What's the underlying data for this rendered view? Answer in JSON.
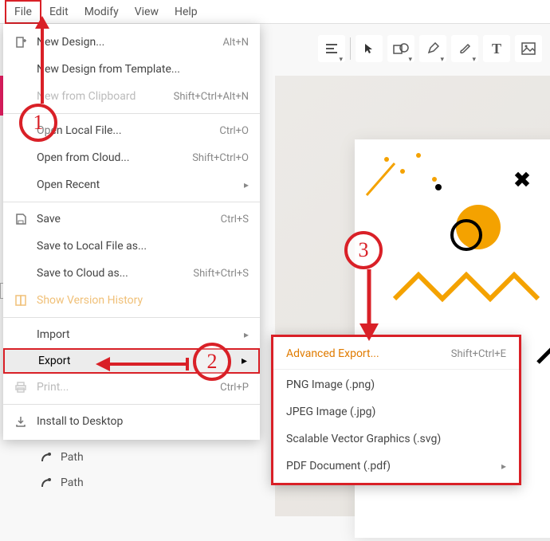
{
  "menubar": {
    "file": "File",
    "edit": "Edit",
    "modify": "Modify",
    "view": "View",
    "help": "Help"
  },
  "file_menu": {
    "new_design": {
      "label": "New Design...",
      "shortcut": "Alt+N"
    },
    "new_template": {
      "label": "New Design from Template..."
    },
    "new_clipboard": {
      "label": "New from Clipboard",
      "shortcut": "Shift+Ctrl+Alt+N"
    },
    "open_local": {
      "label": "Open Local File...",
      "shortcut": "Ctrl+O"
    },
    "open_cloud": {
      "label": "Open from Cloud...",
      "shortcut": "Shift+Ctrl+O"
    },
    "open_recent": {
      "label": "Open Recent"
    },
    "save": {
      "label": "Save",
      "shortcut": "Ctrl+S"
    },
    "save_local": {
      "label": "Save to Local File as..."
    },
    "save_cloud": {
      "label": "Save to Cloud as...",
      "shortcut": "Shift+Ctrl+S"
    },
    "version_history": {
      "label": "Show Version History"
    },
    "import": {
      "label": "Import"
    },
    "export": {
      "label": "Export"
    },
    "print": {
      "label": "Print...",
      "shortcut": "Ctrl+P"
    },
    "install": {
      "label": "Install to Desktop"
    }
  },
  "submenu": {
    "advanced": {
      "label": "Advanced Export...",
      "shortcut": "Shift+Ctrl+E"
    },
    "png": {
      "label": "PNG Image (.png)"
    },
    "jpeg": {
      "label": "JPEG Image (.jpg)"
    },
    "svg": {
      "label": "Scalable Vector Graphics (.svg)"
    },
    "pdf": {
      "label": "PDF Document (.pdf)"
    }
  },
  "sidebar": {
    "path1": "Path",
    "path2": "Path"
  },
  "annotations": {
    "one": "1",
    "two": "2",
    "three": "3"
  }
}
